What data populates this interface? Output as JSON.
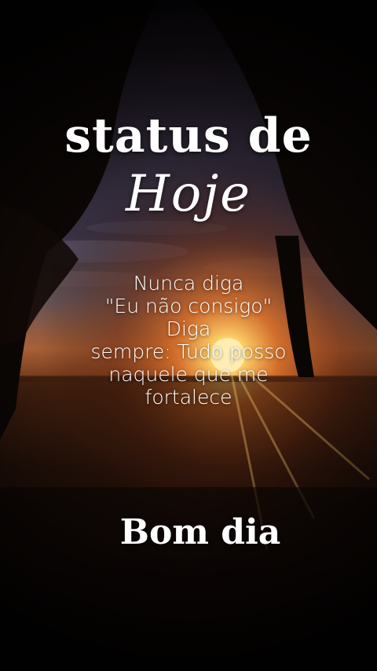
{
  "title": {
    "status": "status de",
    "hoje": "Hoje"
  },
  "quote": {
    "lines": [
      "Nunca diga",
      "\"Eu não consigo\"",
      "Diga",
      "sempre: Tudo posso",
      "naquele que me",
      "fortalece"
    ]
  },
  "greeting": "Bom dia",
  "colors": {
    "text": "#ffffff",
    "sun": "#ffd36a",
    "sky_glow": "#d9702a",
    "dark": "#0b0604"
  }
}
